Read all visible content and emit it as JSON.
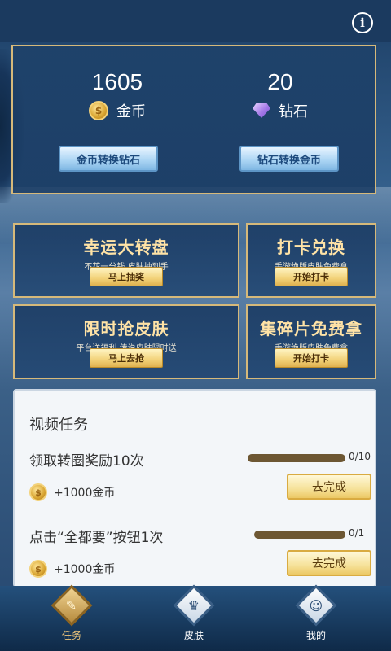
{
  "wallet": {
    "coins": {
      "value": "1605",
      "label": "金币",
      "icon": "coin-icon"
    },
    "diamonds": {
      "value": "20",
      "label": "钻石",
      "icon": "diamond-icon"
    },
    "coin_to_diamond_label": "金币转换钻石",
    "diamond_to_coin_label": "钻石转换金币"
  },
  "cards": [
    {
      "title": "幸运大转盘",
      "subtitle": "不花一分钱 皮肤抽到手",
      "button": "马上抽奖"
    },
    {
      "title": "打卡兑换",
      "subtitle": "手游绝版皮肤免费拿",
      "button": "开始打卡"
    },
    {
      "title": "限时抢皮肤",
      "subtitle": "平台送福利 传说皮肤限时送",
      "button": "马上去抢"
    },
    {
      "title": "集碎片免费拿",
      "subtitle": "手游绝版皮肤免费拿",
      "button": "开始打卡"
    }
  ],
  "tasks": {
    "heading": "视频任务",
    "items": [
      {
        "name": "领取转圈奖励10次",
        "progress": "0/10",
        "progress_fraction": 0,
        "reward": "+1000金币",
        "button": "去完成"
      },
      {
        "name": "点击“全都要”按钮1次",
        "progress": "0/1",
        "progress_fraction": 0,
        "reward": "+1000金币",
        "button": "去完成"
      }
    ]
  },
  "tabs": [
    {
      "label": "任务",
      "icon": "task-icon",
      "active": true
    },
    {
      "label": "皮肤",
      "icon": "skin-icon",
      "active": false
    },
    {
      "label": "我的",
      "icon": "profile-icon",
      "active": false
    }
  ],
  "colors": {
    "accent_gold": "#d6b97a",
    "title_gold": "#ffe3a6",
    "progress_track": "#6d5733"
  }
}
